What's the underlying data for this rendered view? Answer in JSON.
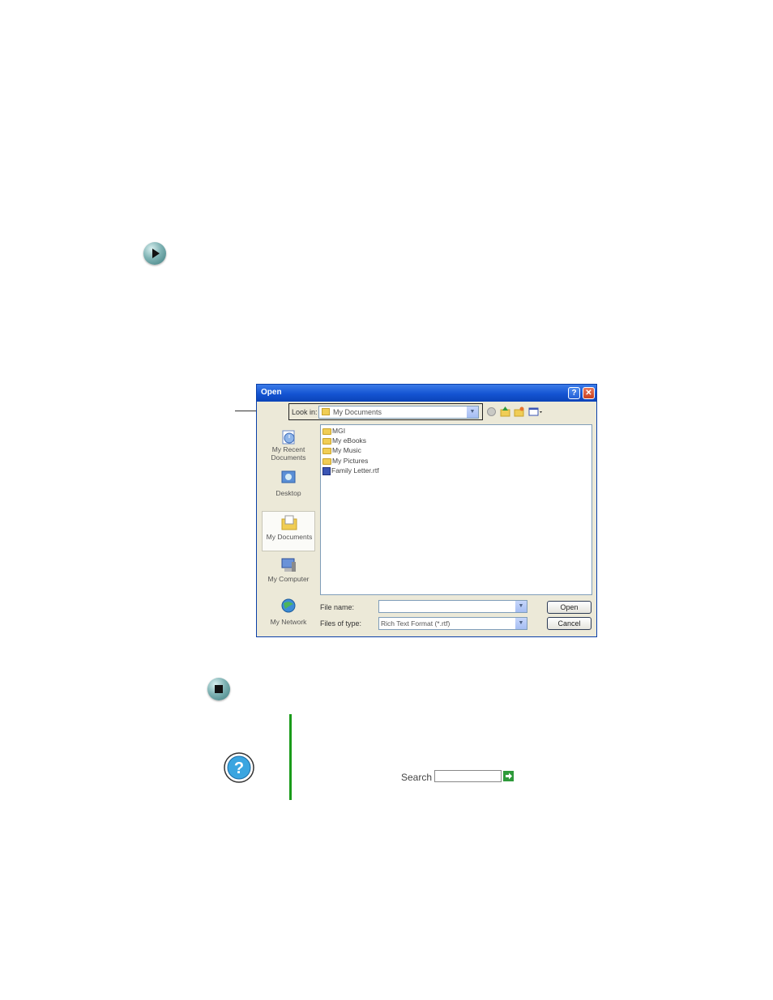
{
  "dialog": {
    "title": "Open",
    "help_button": "?",
    "close_button": "✕",
    "look_in_label": "Look in:",
    "look_in_value": "My Documents",
    "places": [
      {
        "label": "My Recent Documents",
        "icon": "recent-documents-icon"
      },
      {
        "label": "Desktop",
        "icon": "desktop-icon"
      },
      {
        "label": "My Documents",
        "icon": "my-documents-icon"
      },
      {
        "label": "My Computer",
        "icon": "my-computer-icon"
      },
      {
        "label": "My Network",
        "icon": "my-network-icon"
      }
    ],
    "files": [
      {
        "name": "MGI",
        "type": "folder"
      },
      {
        "name": "My eBooks",
        "type": "folder"
      },
      {
        "name": "My Music",
        "type": "folder"
      },
      {
        "name": "My Pictures",
        "type": "folder"
      },
      {
        "name": "Family Letter.rtf",
        "type": "rtf"
      }
    ],
    "file_name_label": "File name:",
    "file_name_value": "",
    "files_of_type_label": "Files of type:",
    "files_of_type_value": "Rich Text Format (*.rtf)",
    "open_button": "Open",
    "cancel_button": "Cancel"
  },
  "help_box": {
    "search_label": "Search"
  },
  "colors": {
    "titlebar": "#1454d2",
    "accent_green": "#1a9b1a",
    "bullet": "#5b9a9b"
  }
}
